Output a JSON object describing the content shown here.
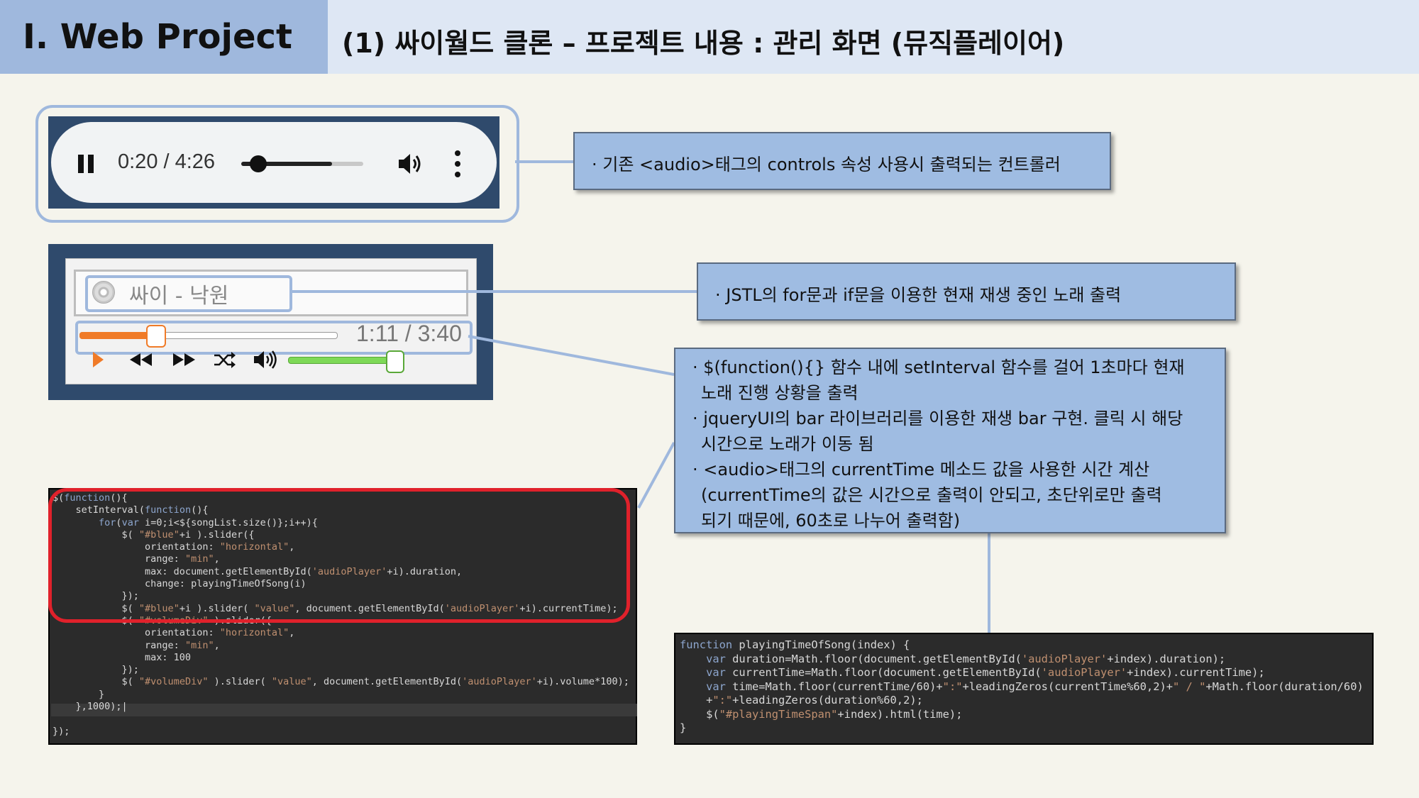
{
  "header": {
    "title": "Ⅰ. Web Project",
    "subtitle": "(1) 싸이월드 클론 – 프로젝트 내용 : 관리 화면 (뮤직플레이어)"
  },
  "audio_controls": {
    "time": "0:20 / 4:26",
    "seek_progress_fraction": 0.08,
    "icons": [
      "pause-icon",
      "volume-icon",
      "more-options-icon"
    ]
  },
  "custom_player": {
    "song_title": "싸이 - 낙원",
    "time": "1:11 / 3:40",
    "progress_fraction": 0.32,
    "volume_fraction": 1.0,
    "icons": [
      "cd-icon",
      "play-icon",
      "rewind-icon",
      "fast-forward-icon",
      "shuffle-icon",
      "volume-icon"
    ],
    "colors": {
      "progress": "#f07b28",
      "volume": "#7ed957"
    }
  },
  "callouts": {
    "c1": [
      "· 기존 <audio>태그의 controls 속성 사용시 출력되는 컨트롤러"
    ],
    "c2": [
      "· JSTL의 for문과 if문을 이용한 현재 재생 중인 노래 출력"
    ],
    "c3": [
      "· $(function(){} 함수 내에 setInterval 함수를 걸어 1초마다 현재",
      "노래 진행 상황을 출력",
      "· jqueryUI의 bar 라이브러리를 이용한 재생 bar 구현. 클릭 시 해당",
      "시간으로 노래가 이동 됨",
      "· <audio>태그의 currentTime 메소드 값을 사용한 시간 계산",
      "(currentTime의 값은 시간으로 출력이 안되고, 초단위로만 출력",
      "되기 때문에, 60초로 나누어 출력함)"
    ]
  },
  "code_left": [
    "$(function(){",
    "    setInterval(function(){",
    "        for(var i=0;i<${songList.size()};i++){",
    "            $( \"#blue\"+i ).slider({",
    "                orientation: \"horizontal\",",
    "                range: \"min\",",
    "                max: document.getElementById('audioPlayer'+i).duration,",
    "                change: playingTimeOfSong(i)",
    "            });",
    "            $( \"#blue\"+i ).slider( \"value\", document.getElementById('audioPlayer'+i).currentTime);",
    "            $( \"#volumeDiv\" ).slider({",
    "                orientation: \"horizontal\",",
    "                range: \"min\",",
    "                max: 100",
    "            });",
    "            $( \"#volumeDiv\" ).slider( \"value\", document.getElementById('audioPlayer'+i).volume*100);",
    "        }",
    "    },1000);|",
    "",
    "});"
  ],
  "code_right": [
    "function playingTimeOfSong(index) {",
    "    var duration=Math.floor(document.getElementById('audioPlayer'+index).duration);",
    "    var currentTime=Math.floor(document.getElementById('audioPlayer'+index).currentTime);",
    "    var time=Math.floor(currentTime/60)+\":\"+leadingZeros(currentTime%60,2)+\" / \"+Math.floor(duration/60)",
    "    +\":\"+leadingZeros(duration%60,2);",
    "    $(\"#playingTimeSpan\"+index).html(time);",
    "}"
  ]
}
